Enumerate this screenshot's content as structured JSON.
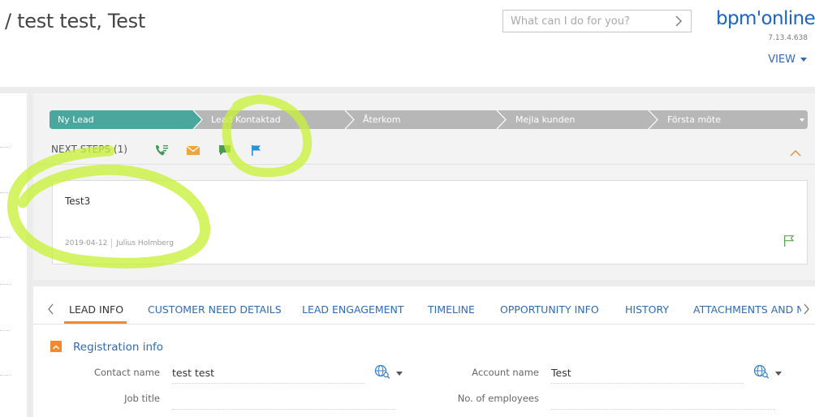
{
  "header": {
    "title": "/ test test, Test",
    "search_placeholder": "What can I do for you?",
    "logo_text": "bpm'online",
    "version": "7.13.4.638",
    "view_label": "VIEW"
  },
  "stages": [
    {
      "label": "Ny Lead",
      "active": true
    },
    {
      "label": "Lead Kontaktad",
      "active": false
    },
    {
      "label": "Återkom",
      "active": false
    },
    {
      "label": "Mejla kunden",
      "active": false
    },
    {
      "label": "Första möte",
      "active": false
    }
  ],
  "next_steps": {
    "label": "NEXT STEPS (1)",
    "icons": [
      "phone-icon",
      "email-icon",
      "chat-icon",
      "flag-icon"
    ]
  },
  "task": {
    "title": "Test3",
    "date": "2019-04-12",
    "owner": "Julius Holmberg"
  },
  "tabs": [
    {
      "label": "LEAD INFO",
      "active": true
    },
    {
      "label": "CUSTOMER NEED DETAILS",
      "active": false
    },
    {
      "label": "LEAD ENGAGEMENT",
      "active": false
    },
    {
      "label": "TIMELINE",
      "active": false
    },
    {
      "label": "OPPORTUNITY INFO",
      "active": false
    },
    {
      "label": "HISTORY",
      "active": false
    },
    {
      "label": "ATTACHMENTS AND N",
      "active": false
    }
  ],
  "registration": {
    "group_title": "Registration info",
    "fields": [
      {
        "label": "Contact name",
        "value": "test test"
      },
      {
        "label": "Account name",
        "value": "Test"
      },
      {
        "label": "Job title",
        "value": ""
      },
      {
        "label": "No. of employees",
        "value": ""
      }
    ]
  },
  "colors": {
    "active_stage": "#4aa79e",
    "inactive_stage": "#b7b7b7",
    "accent": "#f18a2e",
    "link": "#2f6ab3",
    "highlighter": "#c8f03a"
  }
}
